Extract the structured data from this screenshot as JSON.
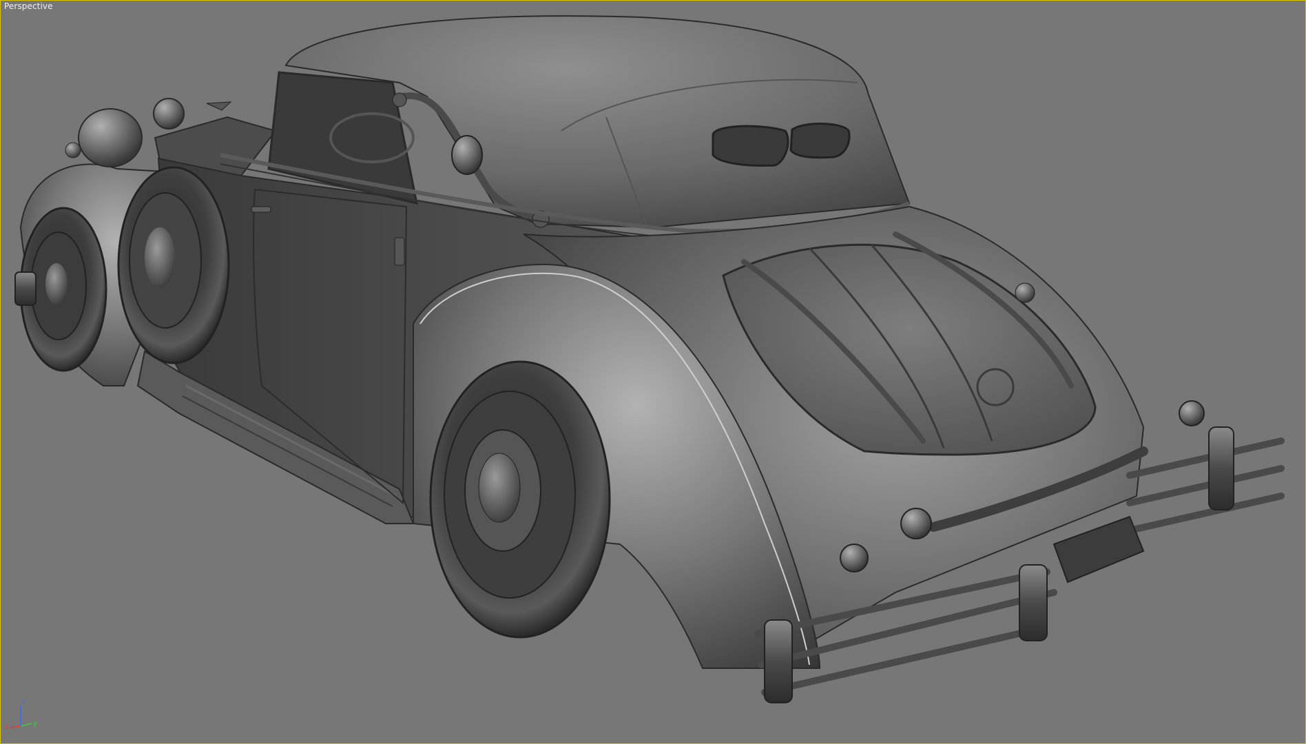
{
  "viewport": {
    "label": "Perspective",
    "active": true,
    "border_color": "#d6c400",
    "background_color": "#777777",
    "shading": "grey clay"
  },
  "scene": {
    "object": "vintage-convertible-car",
    "view": "rear three-quarter"
  },
  "axis_gizmo": {
    "x_label": "x",
    "y_label": "y",
    "z_label": "z",
    "x_color": "#e83a3a",
    "y_color": "#3ad23a",
    "z_color": "#3a6aff"
  }
}
